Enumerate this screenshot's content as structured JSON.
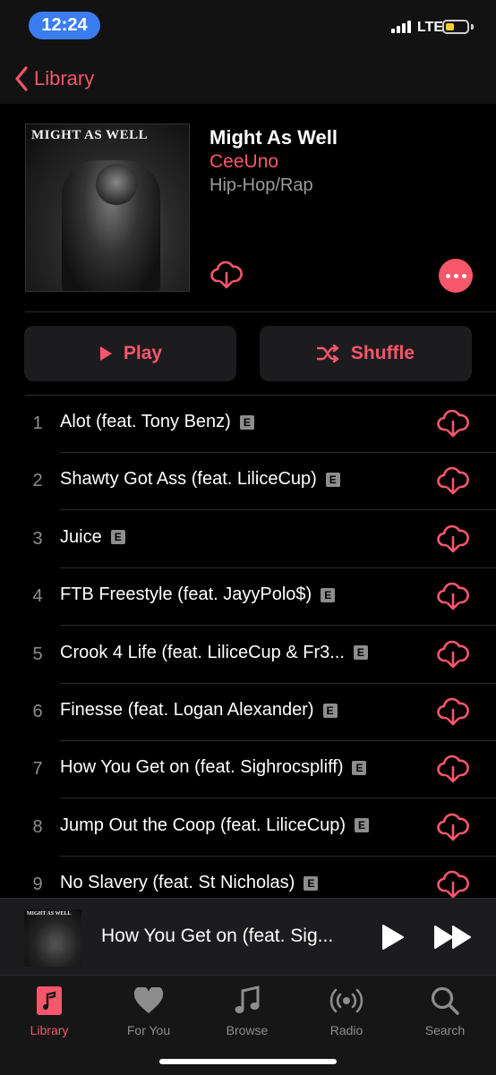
{
  "status": {
    "time": "12:24",
    "carrier": "LTE"
  },
  "nav": {
    "back_label": "Library"
  },
  "album": {
    "cover_text": "MIGHT AS WELL",
    "title": "Might As Well",
    "artist": "CeeUno",
    "genre": "Hip-Hop/Rap"
  },
  "actions": {
    "play_label": "Play",
    "shuffle_label": "Shuffle"
  },
  "explicit_badge": "E",
  "tracks": [
    {
      "num": "1",
      "title": "Alot (feat. Tony Benz)"
    },
    {
      "num": "2",
      "title": "Shawty Got Ass (feat. LiliceCup)"
    },
    {
      "num": "3",
      "title": "Juice"
    },
    {
      "num": "4",
      "title": "FTB Freestyle (feat. JayyPolo$)"
    },
    {
      "num": "5",
      "title": "Crook 4 Life (feat. LiliceCup & Fr3..."
    },
    {
      "num": "6",
      "title": "Finesse (feat. Logan Alexander)"
    },
    {
      "num": "7",
      "title": "How You Get on (feat. Sighrocspliff)"
    },
    {
      "num": "8",
      "title": "Jump Out the Coop (feat. LiliceCup)"
    },
    {
      "num": "9",
      "title": "No Slavery (feat. St Nicholas)"
    }
  ],
  "now_playing": {
    "title": "How You Get on (feat. Sig...",
    "cover_text": "MIGHT AS WELL"
  },
  "tabs": [
    {
      "label": "Library",
      "icon": "library-icon",
      "active": true
    },
    {
      "label": "For You",
      "icon": "heart-icon",
      "active": false
    },
    {
      "label": "Browse",
      "icon": "music-note-icon",
      "active": false
    },
    {
      "label": "Radio",
      "icon": "radio-icon",
      "active": false
    },
    {
      "label": "Search",
      "icon": "search-icon",
      "active": false
    }
  ],
  "colors": {
    "accent": "#f7566b",
    "background": "#000000",
    "secondary_text": "#8d8d8d"
  }
}
